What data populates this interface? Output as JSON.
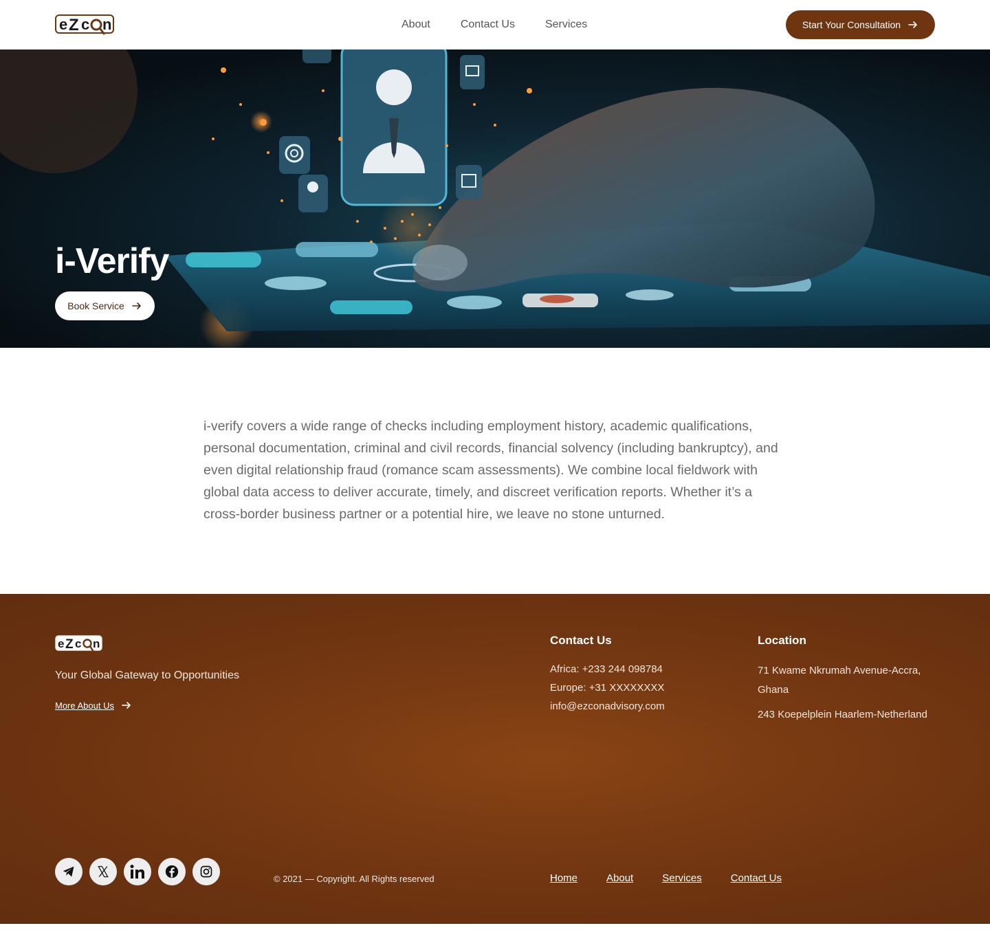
{
  "brand": {
    "logo_text": "ezcon"
  },
  "nav": {
    "items": [
      {
        "label": "About"
      },
      {
        "label": "Contact Us"
      },
      {
        "label": "Services"
      }
    ],
    "cta_label": "Start Your Consultation"
  },
  "hero": {
    "title": "i-Verify",
    "button_label": "Book Service"
  },
  "content": {
    "paragraph": "i-verify covers a wide range of checks including employment history, academic qualifications, personal documentation, criminal and civil records, financial solvency (including bankruptcy), and even digital relationship fraud (romance scam assessments). We combine local fieldwork with global data access to deliver accurate, timely, and discreet verification reports. Whether it’s a cross-border business partner or a potential hire, we leave no stone unturned."
  },
  "footer": {
    "tagline": "Your Global Gateway to  Opportunities",
    "more_link": "More About Us",
    "contact": {
      "title": "Contact Us",
      "africa": "Africa: +233 244 098784",
      "europe": "Europe: +31 XXXXXXXX",
      "email": "info@ezconadvisory.com"
    },
    "location": {
      "title": "Location",
      "address1": "71 Kwame Nkrumah Avenue-Accra, Ghana",
      "address2": "243 Koepelplein Haarlem-Netherland"
    },
    "socials": [
      "telegram-icon",
      "x-icon",
      "linkedin-icon",
      "facebook-icon",
      "instagram-icon"
    ],
    "copyright": "© 2021 — Copyright. All Rights reserved",
    "links": [
      {
        "label": "Home"
      },
      {
        "label": "About"
      },
      {
        "label": "Services"
      },
      {
        "label": "Contact Us"
      }
    ]
  },
  "colors": {
    "brand_brown": "#6f3410",
    "footer_bg": "#783a12",
    "text_gray": "#6a6a6a"
  }
}
